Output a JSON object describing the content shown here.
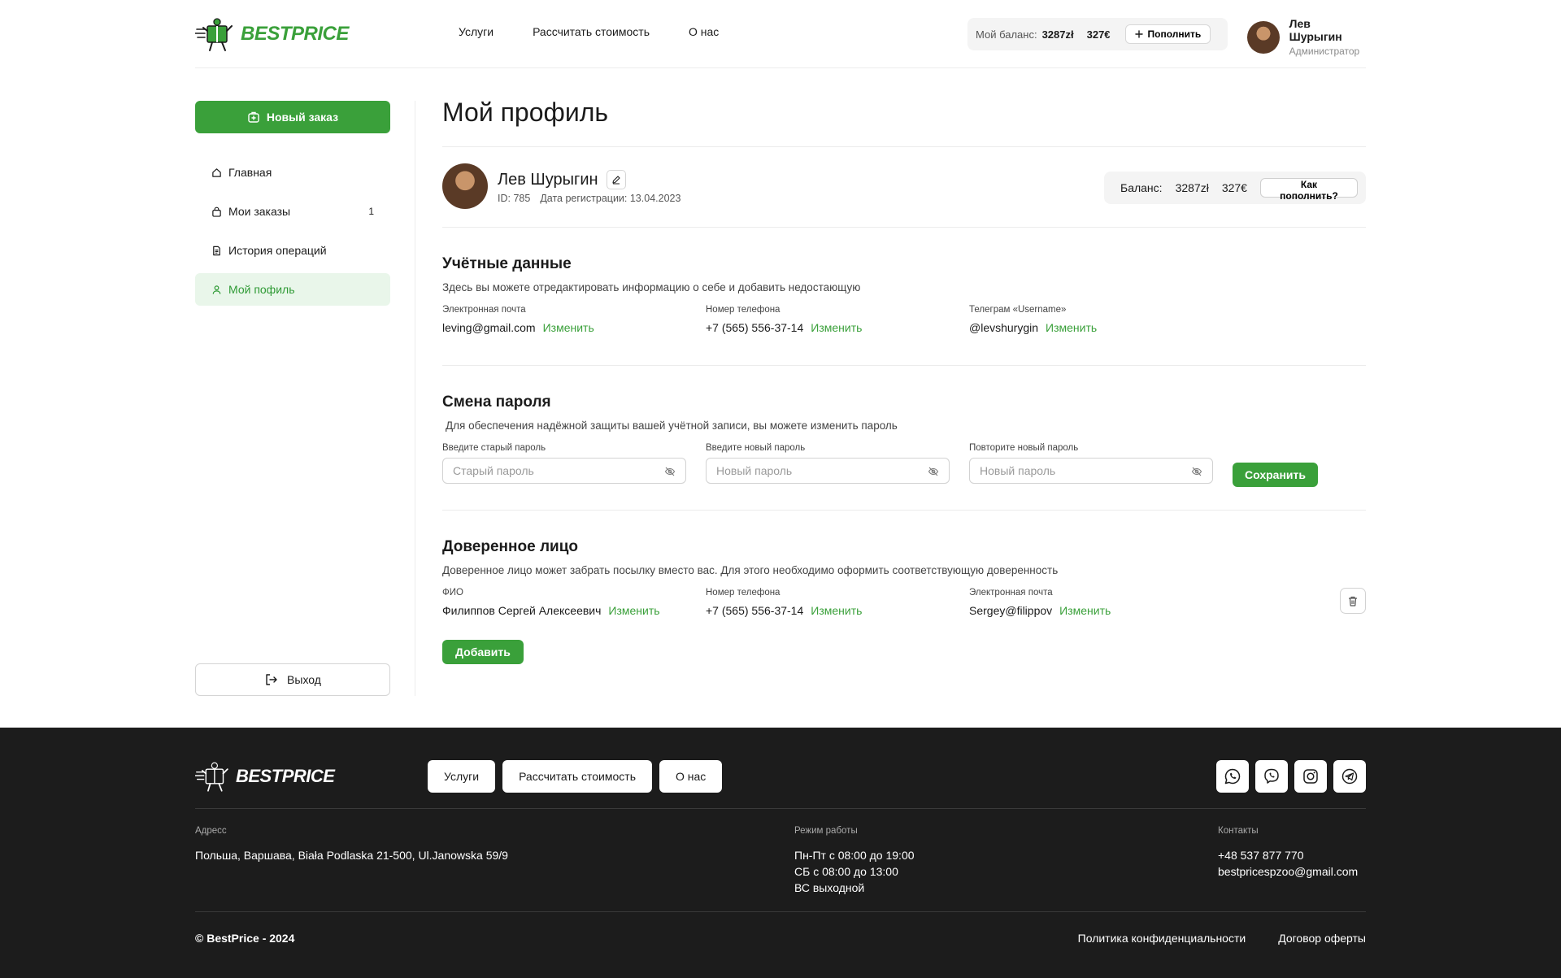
{
  "brand": {
    "part1": "BEST",
    "part2": "PRICE",
    "accent": "#3aa03a",
    "icon": "courier-box-icon"
  },
  "header": {
    "nav": [
      "Услуги",
      "Рассчитать стоимость",
      "О нас"
    ],
    "balance_label": "Мой баланс:",
    "balance_pln": "3287zł",
    "balance_eur": "327€",
    "topup_label": "Пополнить",
    "user_name": "Лев Шурыгин",
    "user_role": "Администратор"
  },
  "sidebar": {
    "new_order": "Новый заказ",
    "items": [
      {
        "label": "Главная",
        "icon": "home-icon",
        "count": ""
      },
      {
        "label": "Мои заказы",
        "icon": "bag-icon",
        "count": "1"
      },
      {
        "label": "История операций",
        "icon": "document-icon",
        "count": ""
      },
      {
        "label": "Мой пофиль",
        "icon": "user-icon",
        "count": "",
        "active": true
      }
    ],
    "logout": "Выход"
  },
  "profile": {
    "page_title": "Мой профиль",
    "name": "Лев Шурыгин",
    "id_text": "ID: 785",
    "reg_text": "Дата регистрации: 13.04.2023",
    "balance_label": "Баланс:",
    "balance_pln": "3287zł",
    "balance_eur": "327€",
    "how_topup": "Как пополнить?"
  },
  "account": {
    "title": "Учётные данные",
    "desc": "Здесь вы можете отредактировать информацию о себе и добавить недостающую",
    "change": "Изменить",
    "fields": [
      {
        "label": "Электронная почта",
        "value": "leving@gmail.com"
      },
      {
        "label": "Номер телефона",
        "value": "+7 (565) 556-37-14"
      },
      {
        "label": "Телеграм «Username»",
        "value": "@levshurygin"
      }
    ]
  },
  "password": {
    "title": "Смена пароля",
    "desc": "Для обеспечения надёжной защиты вашей учётной записи, вы можете изменить пароль",
    "fields": [
      {
        "label": "Введите старый пароль",
        "placeholder": "Старый пароль"
      },
      {
        "label": "Введите новый пароль",
        "placeholder": "Новый пароль"
      },
      {
        "label": "Повторите новый пароль",
        "placeholder": "Новый пароль"
      }
    ],
    "save": "Сохранить"
  },
  "trusted": {
    "title": "Доверенное лицо",
    "desc": "Доверенное лицо может забрать посылку вместо вас. Для этого необходимо оформить соответствующую доверенность",
    "change": "Изменить",
    "fields": [
      {
        "label": "ФИО",
        "value": "Филиппов Сергей Алексеевич"
      },
      {
        "label": "Номер телефона",
        "value": "+7 (565) 556-37-14"
      },
      {
        "label": "Электронная почта",
        "value": "Sergey@filippov"
      }
    ],
    "add": "Добавить"
  },
  "footer": {
    "nav": [
      "Услуги",
      "Рассчитать стоимость",
      "О нас"
    ],
    "socials": [
      "whatsapp-icon",
      "viber-icon",
      "instagram-icon",
      "telegram-icon"
    ],
    "address_label": "Адресс",
    "address": "Польша, Варшава, Biała Podlaska 21-500, Ul.Janowska 59/9",
    "hours_label": "Режим работы",
    "hours": [
      "Пн-Пт с 08:00 до 19:00",
      "СБ с 08:00 до 13:00",
      "ВС выходной"
    ],
    "contacts_label": "Контакты",
    "phone": "+48 537 877 770",
    "email": "bestpricespzoo@gmail.com",
    "copyright": "© BestPrice - 2024",
    "privacy": "Политика конфиденциальности",
    "offer": "Договор оферты"
  }
}
